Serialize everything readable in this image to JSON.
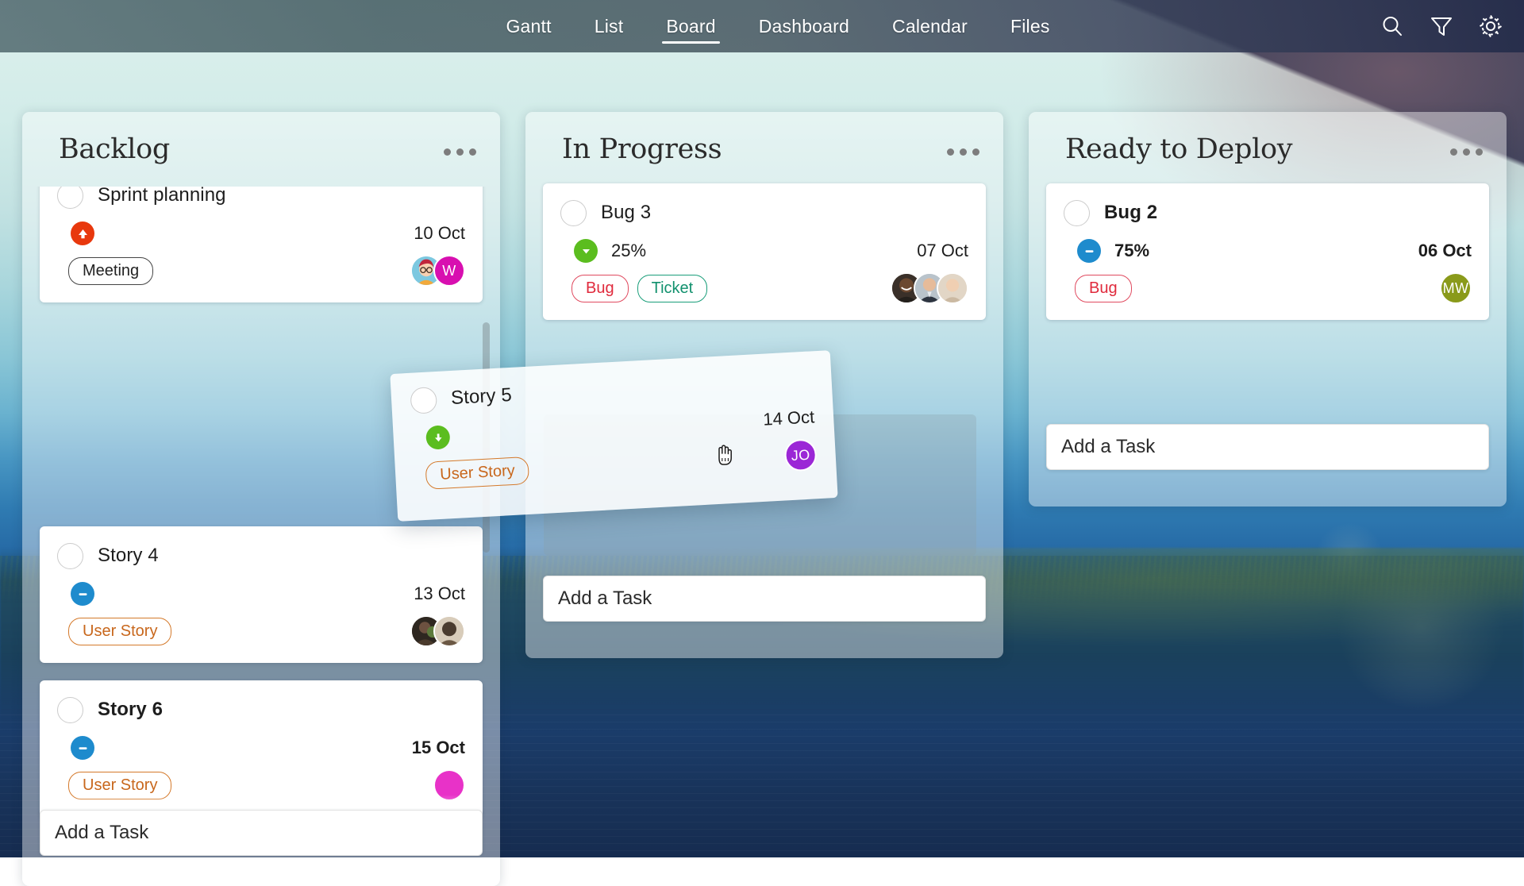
{
  "nav": {
    "tabs": [
      {
        "label": "Gantt",
        "active": false
      },
      {
        "label": "List",
        "active": false
      },
      {
        "label": "Board",
        "active": true
      },
      {
        "label": "Dashboard",
        "active": false
      },
      {
        "label": "Calendar",
        "active": false
      },
      {
        "label": "Files",
        "active": false
      }
    ],
    "icons": [
      "search-icon",
      "filter-icon",
      "gear-icon"
    ]
  },
  "colors": {
    "priority_high": "#e8380d",
    "priority_normal": "#1e8bcd",
    "priority_low": "#5bbd1f",
    "tag_story": "#c8671c",
    "tag_bug": "#e02a3c",
    "tag_ticket": "#12916e",
    "tag_meeting": "#222222",
    "avatar_w": "#d80fb0",
    "avatar_mw": "#8a9a1a",
    "avatar_jo": "#9b27d6",
    "active_tab_underline": "#ffffff"
  },
  "columns": [
    {
      "title": "Backlog",
      "menu": "column-menu",
      "add_task_label": "Add a Task",
      "cards": [
        {
          "title": "Sprint planning",
          "bold": false,
          "priority": "high",
          "progress": "",
          "due": "10 Oct",
          "tags": [
            {
              "label": "Meeting",
              "kind": "meeting"
            }
          ],
          "avatars": [
            {
              "kind": "photo-illustration",
              "label": ""
            },
            {
              "kind": "initials",
              "label": "W",
              "color": "#d80fb0"
            }
          ]
        },
        {
          "title": "Story 4",
          "bold": false,
          "priority": "normal",
          "progress": "",
          "due": "13 Oct",
          "tags": [
            {
              "label": "User Story",
              "kind": "story"
            }
          ],
          "avatars": [
            {
              "kind": "photo",
              "label": ""
            },
            {
              "kind": "photo",
              "label": ""
            }
          ]
        },
        {
          "title": "Story 6",
          "bold": true,
          "priority": "normal",
          "progress": "",
          "due": "15 Oct",
          "tags": [
            {
              "label": "User Story",
              "kind": "story"
            }
          ],
          "avatars": [
            {
              "kind": "initials",
              "label": "",
              "color": "#e832c8"
            }
          ]
        }
      ]
    },
    {
      "title": "In Progress",
      "menu": "column-menu",
      "add_task_label": "Add a Task",
      "cards": [
        {
          "title": "Bug 3",
          "bold": false,
          "priority": "low",
          "progress": "25%",
          "due": "07 Oct",
          "tags": [
            {
              "label": "Bug",
              "kind": "bug"
            },
            {
              "label": "Ticket",
              "kind": "ticket"
            }
          ],
          "avatars": [
            {
              "kind": "photo",
              "label": ""
            },
            {
              "kind": "photo",
              "label": ""
            },
            {
              "kind": "photo",
              "label": ""
            }
          ]
        }
      ]
    },
    {
      "title": "Ready to Deploy",
      "menu": "column-menu",
      "add_task_label": "Add a Task",
      "cards": [
        {
          "title": "Bug 2",
          "bold": true,
          "priority": "normal",
          "progress": "75%",
          "due": "06 Oct",
          "tags": [
            {
              "label": "Bug",
              "kind": "bug"
            }
          ],
          "avatars": [
            {
              "kind": "initials",
              "label": "MW",
              "color": "#8a9a1a"
            }
          ]
        }
      ]
    }
  ],
  "drag": {
    "card": {
      "title": "Story 5",
      "bold": false,
      "priority": "low",
      "progress": "",
      "due": "14 Oct",
      "tags": [
        {
          "label": "User Story",
          "kind": "story"
        }
      ],
      "avatars": [
        {
          "kind": "initials",
          "label": "JO",
          "color": "#9b27d6"
        }
      ]
    },
    "cursor": "grab-hand-cursor",
    "target_column": "In Progress"
  }
}
